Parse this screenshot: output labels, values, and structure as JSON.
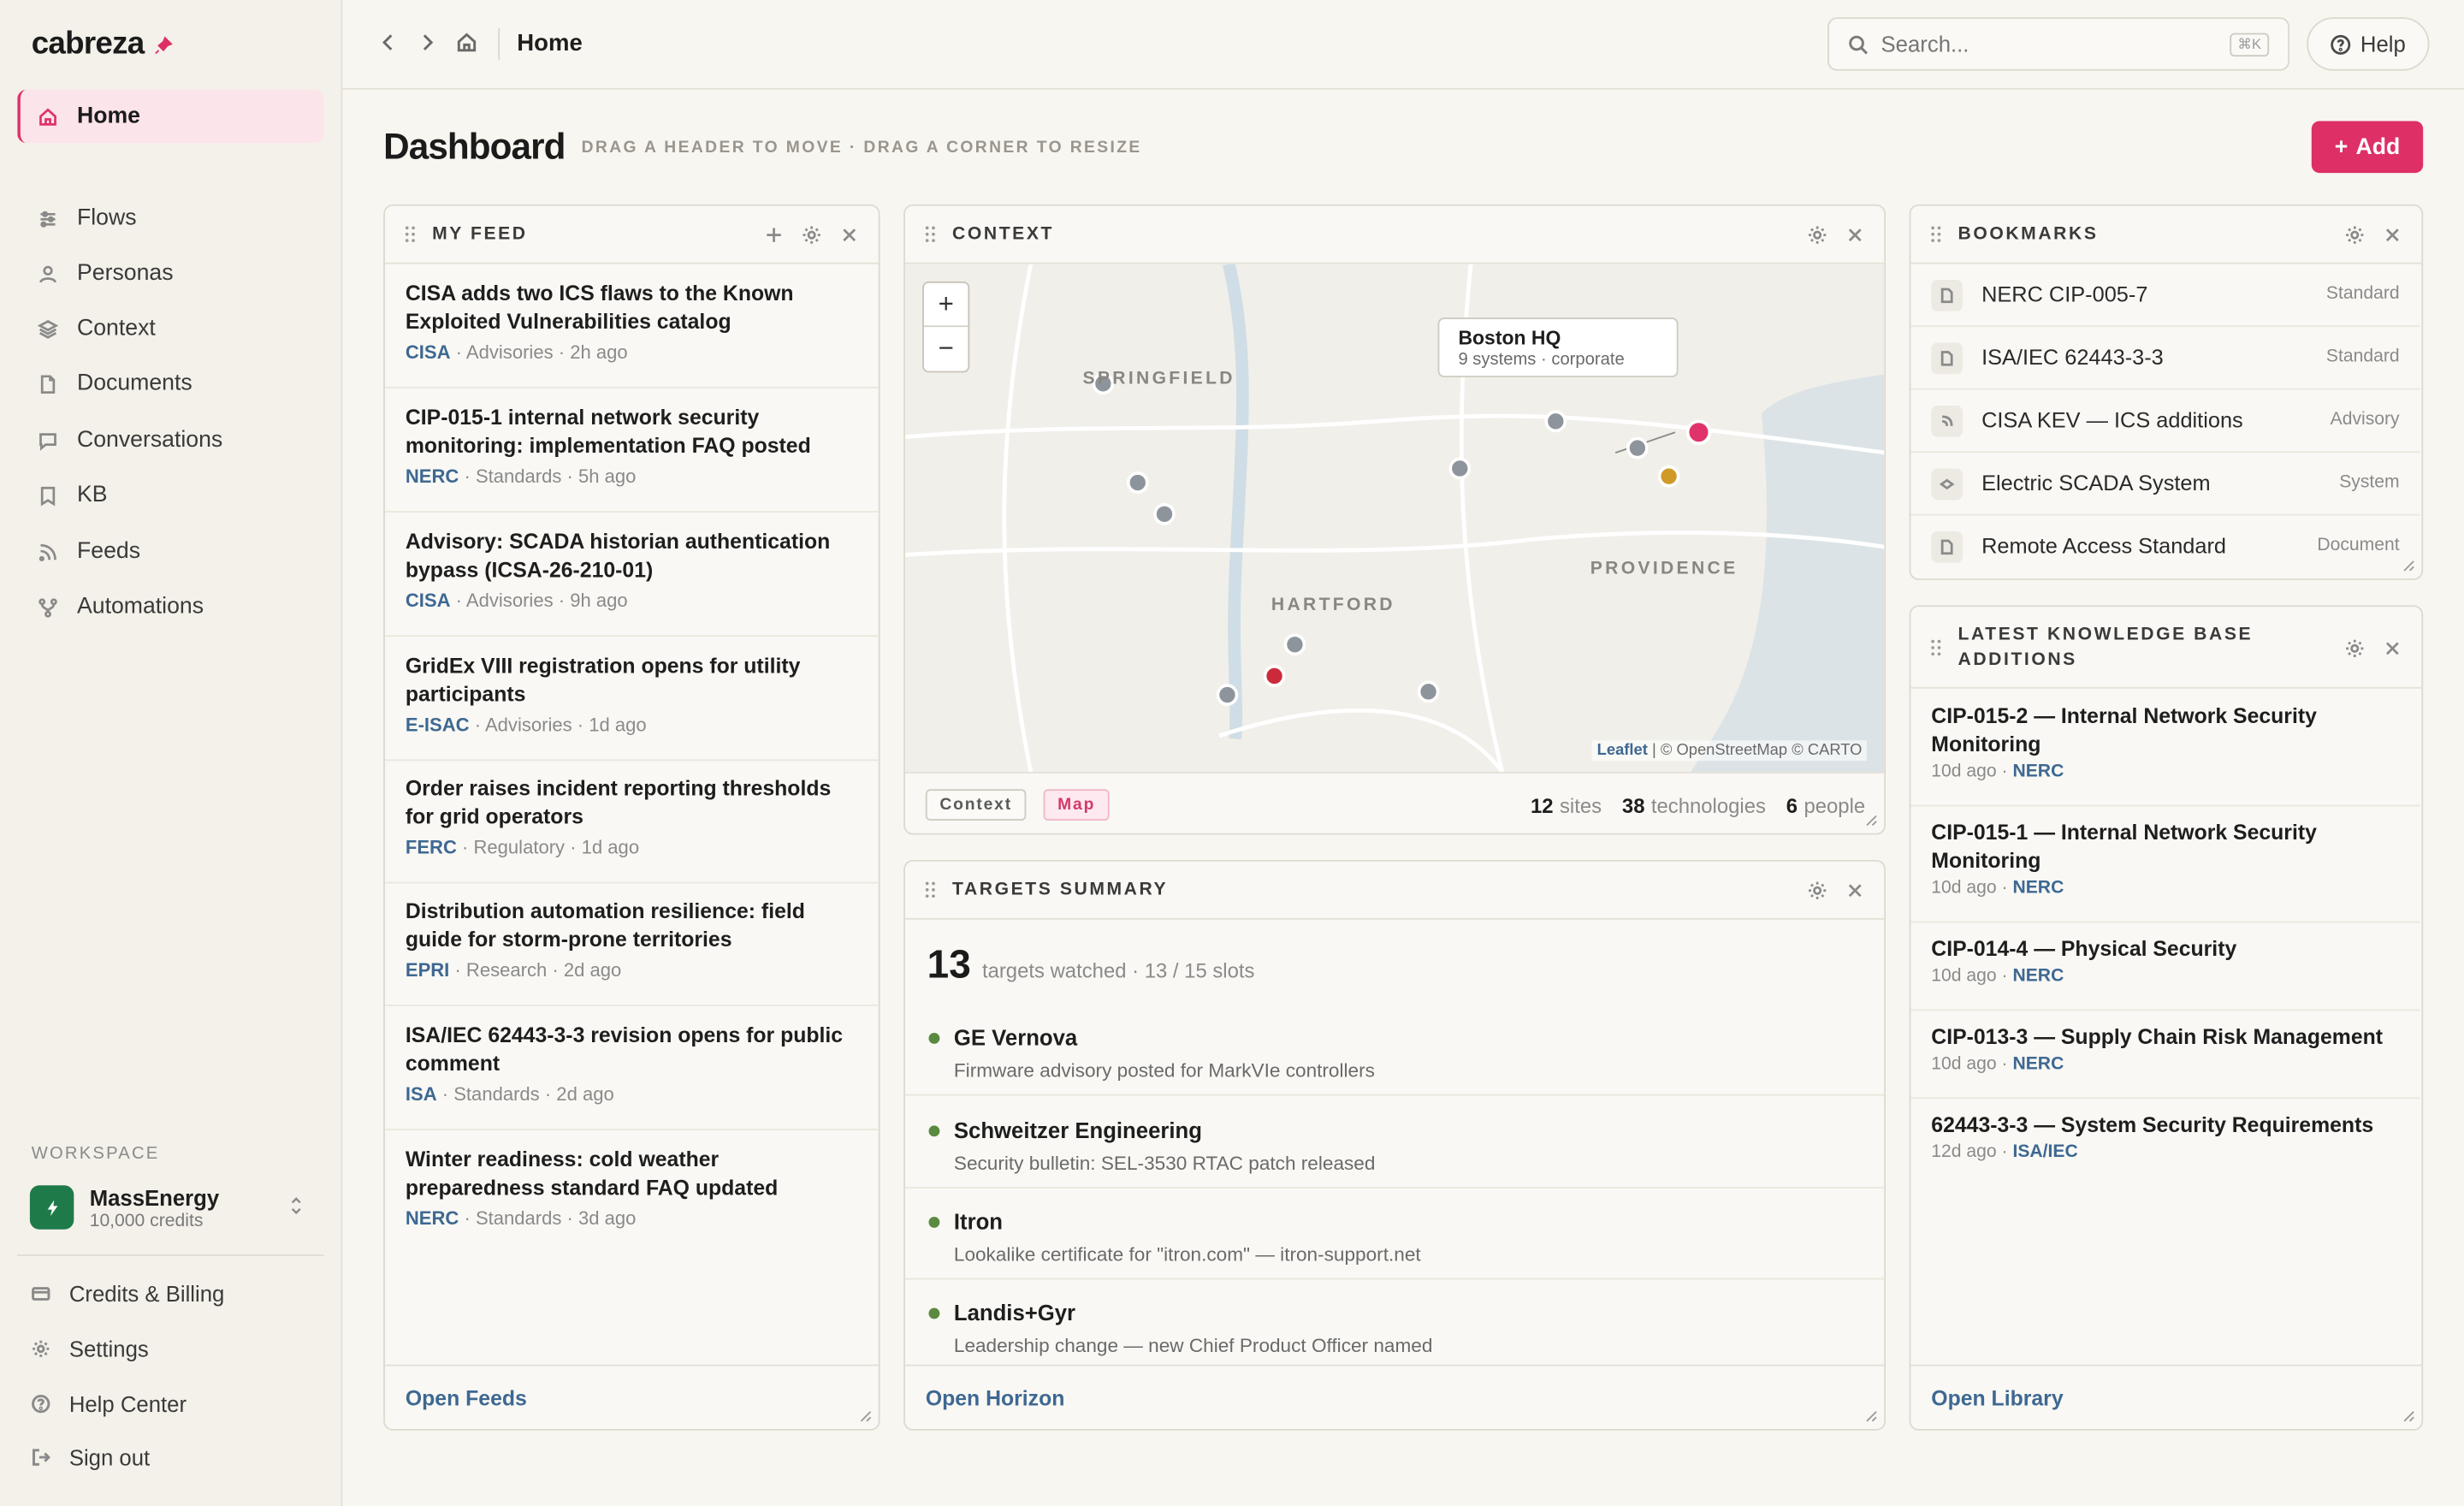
{
  "app": {
    "name": "cabreza"
  },
  "colors": {
    "accent": "#de2f66",
    "link": "#3e6892",
    "status_ok": "#5a8a40",
    "pin_primary": "#e0336b",
    "pin_alert": "#cc2a3a",
    "pin_warn": "#d09a28",
    "pin_default": "#8e949b"
  },
  "sidebar": {
    "items": [
      {
        "label": "Home",
        "icon": "home-icon"
      },
      {
        "label": "Flows",
        "icon": "sliders-icon"
      },
      {
        "label": "Personas",
        "icon": "person-icon"
      },
      {
        "label": "Context",
        "icon": "layers-icon"
      },
      {
        "label": "Documents",
        "icon": "document-icon"
      },
      {
        "label": "Conversations",
        "icon": "chat-icon"
      },
      {
        "label": "KB",
        "icon": "book-icon"
      },
      {
        "label": "Feeds",
        "icon": "rss-icon"
      },
      {
        "label": "Automations",
        "icon": "branch-icon"
      }
    ],
    "workspace_label": "WORKSPACE",
    "workspace": {
      "name": "MassEnergy",
      "credits": "10,000 credits"
    },
    "footer": [
      {
        "label": "Credits & Billing",
        "icon": "card-icon"
      },
      {
        "label": "Settings",
        "icon": "gear-icon"
      },
      {
        "label": "Help Center",
        "icon": "question-icon"
      },
      {
        "label": "Sign out",
        "icon": "signout-icon"
      }
    ]
  },
  "topbar": {
    "breadcrumb": "Home",
    "search_placeholder": "Search...",
    "search_shortcut": "⌘K",
    "help_label": "Help"
  },
  "header": {
    "title": "Dashboard",
    "hint": "DRAG A HEADER TO MOVE · DRAG A CORNER TO RESIZE",
    "add_label": "Add"
  },
  "feed": {
    "title": "MY FEED",
    "items": [
      {
        "title": "CISA adds two ICS flaws to the Known Exploited Vulnerabilities catalog",
        "source": "CISA",
        "category": "Advisories",
        "time": "2h ago"
      },
      {
        "title": "CIP-015-1 internal network security monitoring: implementation FAQ posted",
        "source": "NERC",
        "category": "Standards",
        "time": "5h ago"
      },
      {
        "title": "Advisory: SCADA historian authentication bypass (ICSA-26-210-01)",
        "source": "CISA",
        "category": "Advisories",
        "time": "9h ago"
      },
      {
        "title": "GridEx VIII registration opens for utility participants",
        "source": "E-ISAC",
        "category": "Advisories",
        "time": "1d ago"
      },
      {
        "title": "Order raises incident reporting thresholds for grid operators",
        "source": "FERC",
        "category": "Regulatory",
        "time": "1d ago"
      },
      {
        "title": "Distribution automation resilience: field guide for storm-prone territories",
        "source": "EPRI",
        "category": "Research",
        "time": "2d ago"
      },
      {
        "title": "ISA/IEC 62443-3-3 revision opens for public comment",
        "source": "ISA",
        "category": "Standards",
        "time": "2d ago"
      },
      {
        "title": "Winter readiness: cold weather preparedness standard FAQ updated",
        "source": "NERC",
        "category": "Standards",
        "time": "3d ago"
      }
    ],
    "footer_link": "Open Feeds"
  },
  "context": {
    "title": "CONTEXT",
    "map": {
      "cities": [
        "SPRINGFIELD",
        "HARTFORD",
        "PROVIDENCE"
      ],
      "tooltip": {
        "title": "Boston HQ",
        "subtitle": "9 systems · corporate"
      },
      "attribution_leaflet": "Leaflet",
      "attribution_rest": " | © OpenStreetMap © CARTO"
    },
    "tags": [
      "Context",
      "Map"
    ],
    "stats": [
      {
        "value": "12",
        "label": "sites"
      },
      {
        "value": "38",
        "label": "technologies"
      },
      {
        "value": "6",
        "label": "people"
      }
    ]
  },
  "targets": {
    "title": "TARGETS SUMMARY",
    "count": "13",
    "subtitle": "targets watched · 13 / 15 slots",
    "items": [
      {
        "name": "GE Vernova",
        "desc": "Firmware advisory posted for MarkVIe controllers"
      },
      {
        "name": "Schweitzer Engineering",
        "desc": "Security bulletin: SEL-3530 RTAC patch released"
      },
      {
        "name": "Itron",
        "desc": "Lookalike certificate for \"itron.com\" — itron-support.net"
      },
      {
        "name": "Landis+Gyr",
        "desc": "Leadership change — new Chief Product Officer named"
      }
    ],
    "footer_link": "Open Horizon"
  },
  "bookmarks": {
    "title": "BOOKMARKS",
    "items": [
      {
        "title": "NERC CIP-005-7",
        "kind": "Standard",
        "icon": "document-icon"
      },
      {
        "title": "ISA/IEC 62443-3-3",
        "kind": "Standard",
        "icon": "document-icon"
      },
      {
        "title": "CISA KEV — ICS additions",
        "kind": "Advisory",
        "icon": "rss-icon"
      },
      {
        "title": "Electric SCADA System",
        "kind": "System",
        "icon": "chip-icon"
      },
      {
        "title": "Remote Access Standard",
        "kind": "Document",
        "icon": "document-icon"
      }
    ]
  },
  "kb": {
    "title_line1": "LATEST KNOWLEDGE BASE",
    "title_line2": "ADDITIONS",
    "items": [
      {
        "title": "CIP-015-2 — Internal Network Security Monitoring",
        "time": "10d ago",
        "source": "NERC"
      },
      {
        "title": "CIP-015-1 — Internal Network Security Monitoring",
        "time": "10d ago",
        "source": "NERC"
      },
      {
        "title": "CIP-014-4 — Physical Security",
        "time": "10d ago",
        "source": "NERC"
      },
      {
        "title": "CIP-013-3 — Supply Chain Risk Management",
        "time": "10d ago",
        "source": "NERC"
      },
      {
        "title": "62443-3-3 — System Security Requirements",
        "time": "12d ago",
        "source": "ISA/IEC"
      }
    ],
    "footer_link": "Open Library"
  }
}
